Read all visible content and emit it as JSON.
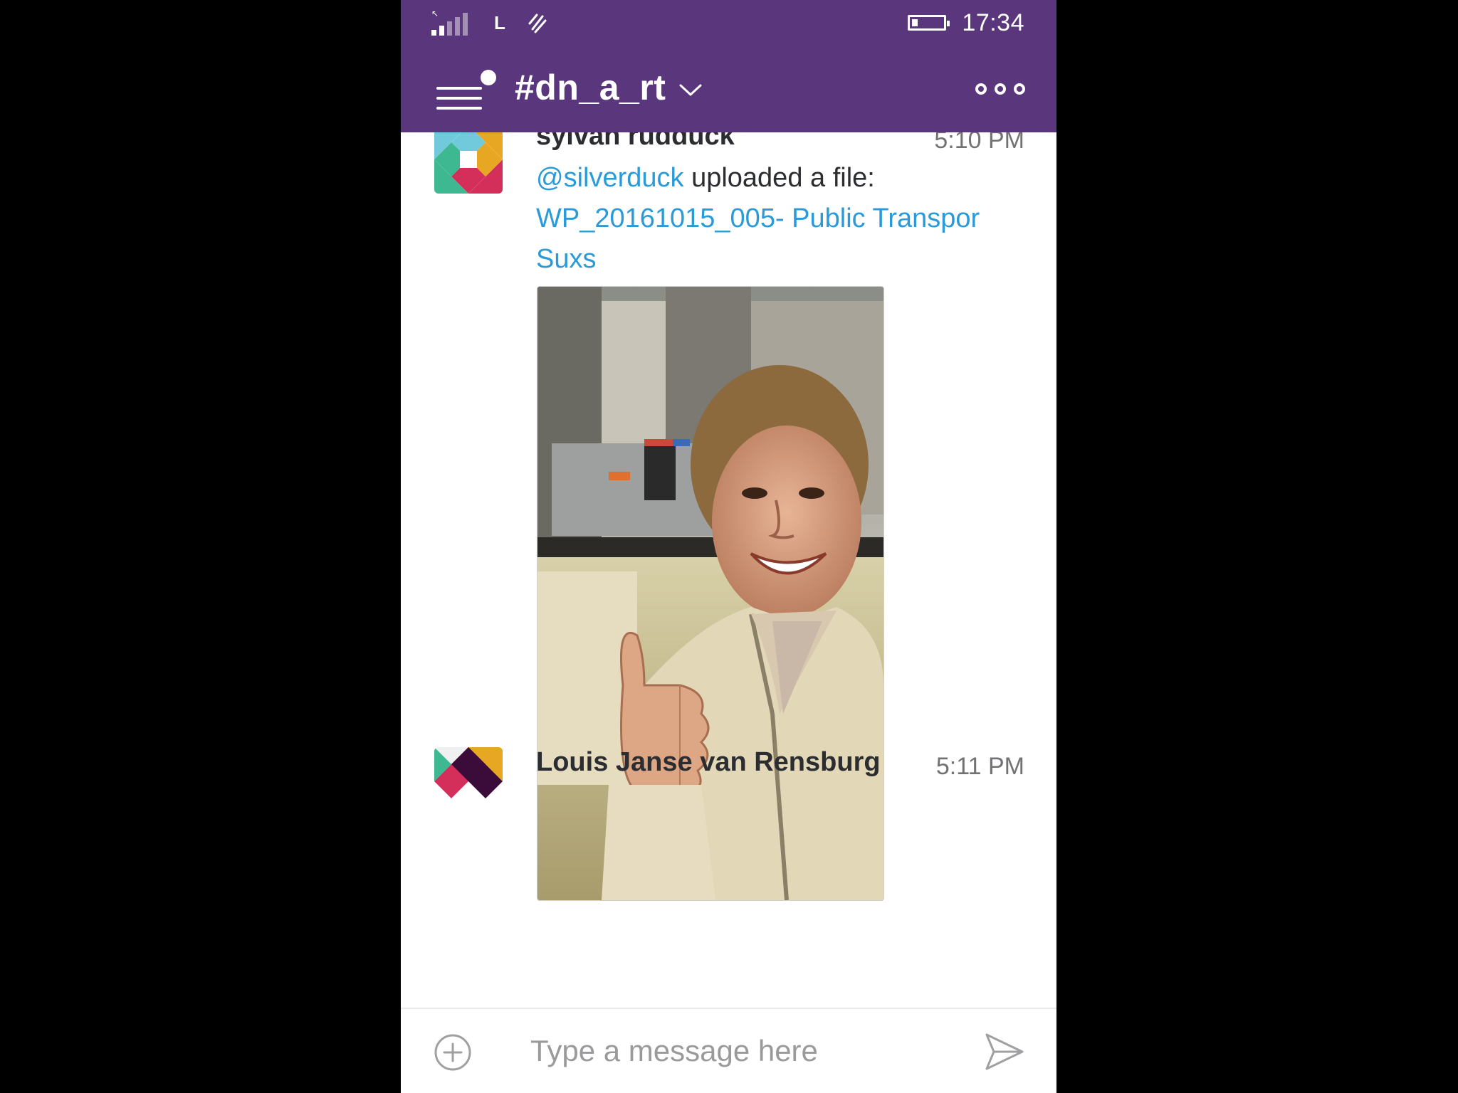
{
  "status_bar": {
    "network_label": "L",
    "time": "17:34",
    "battery_level": 0.2,
    "signal_icon": "signal-icon",
    "data_icon": "data-transfer-icon",
    "battery_icon": "battery-icon"
  },
  "header": {
    "channel_name": "#dn_a_rt",
    "menu_icon": "hamburger-menu-icon",
    "dropdown_icon": "chevron-down-icon",
    "more_icon": "more-options-icon",
    "background_color": "#5a367c"
  },
  "messages": [
    {
      "username": "sylvan rudduck",
      "time": "5:10 PM",
      "mention": "@silverduck",
      "text": " uploaded a file: ",
      "file_name": "WP_20161015_005- Public Transpor Suxs",
      "attachment": "photo of a smiling man giving a thumbs up on a bus"
    },
    {
      "username": "Louis Janse van Rensburg",
      "time": "5:11 PM"
    }
  ],
  "composer": {
    "placeholder": "Type a message here",
    "attach_icon": "add-circle-icon",
    "send_icon": "send-icon"
  },
  "colors": {
    "accent": "#5a367c",
    "link": "#2a9bd8",
    "text": "#2c2d30",
    "muted": "#717274"
  }
}
